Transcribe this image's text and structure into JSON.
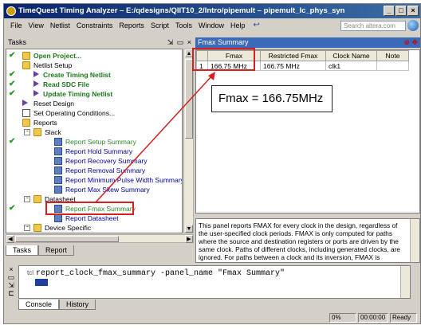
{
  "window": {
    "title": "TimeQuest Timing Analyzer – E:/qdesigns/QIIT10_2/Intro/pipemult – pipemult_lc_phys_syn"
  },
  "menu": [
    "File",
    "View",
    "Netlist",
    "Constraints",
    "Reports",
    "Script",
    "Tools",
    "Window",
    "Help"
  ],
  "search": {
    "placeholder": "Search altera.com"
  },
  "tasks": {
    "header": "Tasks",
    "header_tools": "⨯ □ ×",
    "items": [
      {
        "label": "Open Project...",
        "check": true
      },
      {
        "label": "Netlist Setup",
        "check": false
      },
      {
        "label": "Create Timing Netlist",
        "check": true
      },
      {
        "label": "Read SDC File",
        "check": true
      },
      {
        "label": "Update Timing Netlist",
        "check": true
      },
      {
        "label": "Reset Design",
        "check": false
      },
      {
        "label": "Set Operating Conditions...",
        "check": false
      },
      {
        "label": "Reports",
        "check": false
      },
      {
        "label": "Slack",
        "check": false
      },
      {
        "label": "Report Setup Summary",
        "check": true
      },
      {
        "label": "Report Hold Summary",
        "check": false
      },
      {
        "label": "Report Recovery Summary",
        "check": false
      },
      {
        "label": "Report Removal Summary",
        "check": false
      },
      {
        "label": "Report Minimum Pulse Width Summary",
        "check": false
      },
      {
        "label": "Report Max Skew Summary",
        "check": false
      },
      {
        "label": "Datasheet",
        "check": false
      },
      {
        "label": "Report Fmax Summary",
        "check": true
      },
      {
        "label": "Report Datasheet",
        "check": false
      },
      {
        "label": "Device Specific",
        "check": false
      }
    ],
    "tabs": [
      "Tasks",
      "Report"
    ]
  },
  "fmax": {
    "title": "Fmax Summary",
    "columns": [
      "",
      "Fmax",
      "Restricted Fmax",
      "Clock Name",
      "Note"
    ],
    "rows": [
      {
        "num": "1",
        "fmax": "166.75 MHz",
        "restricted": "166.75 MHz",
        "clock": "clk1",
        "note": ""
      }
    ],
    "description": "This panel reports FMAX for every clock in the design, regardless of the user-specified clock periods. FMAX is only computed for paths where the source and destination registers or ports are driven by the same clock. Paths of different clocks, including generated clocks, are ignored. For paths between a clock and its inversion, FMAX is computed as if the"
  },
  "callout": {
    "text": "Fmax = 166.75MHz"
  },
  "console": {
    "prompt": "tcl",
    "command": "report_clock_fmax_summary -panel_name \"Fmax Summary\"",
    "tabs": [
      "Console",
      "History"
    ]
  },
  "status": {
    "progress": "0%",
    "time": "00:00:00",
    "state": "Ready"
  },
  "colors": {
    "accent": "#d42020",
    "title_bg": "#0a246a",
    "check": "#2a9a2a"
  }
}
